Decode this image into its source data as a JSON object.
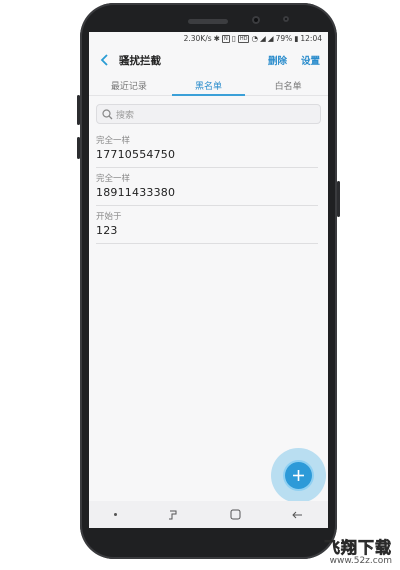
{
  "status_bar": {
    "speed": "2.30K/s",
    "battery": "79%",
    "time": "12:04",
    "hd_badge": "HD",
    "n_badge": "N"
  },
  "header": {
    "title": "骚扰拦截",
    "delete_label": "删除",
    "settings_label": "设置"
  },
  "tabs": [
    {
      "label": "最近记录",
      "active": false
    },
    {
      "label": "黑名单",
      "active": true
    },
    {
      "label": "白名单",
      "active": false
    }
  ],
  "search": {
    "placeholder": "搜索"
  },
  "blacklist": [
    {
      "type": "完全一样",
      "value": "17710554750"
    },
    {
      "type": "完全一样",
      "value": "18911433380"
    },
    {
      "type": "开始于",
      "value": "123"
    }
  ],
  "fab": {
    "icon": "plus-icon"
  },
  "watermark": {
    "logo": "飞翔下载",
    "url": "www.52z.com"
  },
  "colors": {
    "accent": "#2a8ccc",
    "fab": "#2d9ad8"
  }
}
